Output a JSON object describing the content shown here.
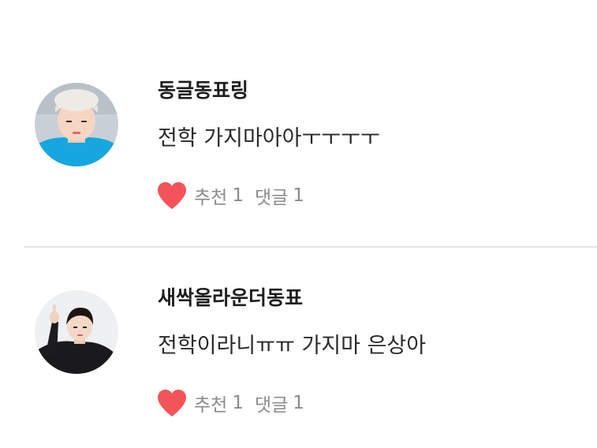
{
  "comments": [
    {
      "username": "동글동표링",
      "text": "전학 가지마아아ㅜㅜㅜㅜ",
      "recommend_label": "추천",
      "recommend_count": "1",
      "reply_label": "댓글",
      "reply_count": "1",
      "avatar_icon": "profile-photo",
      "heart_icon": "heart-icon"
    },
    {
      "username": "새싹올라운더동표",
      "text": "전학이라니ㅠㅠ 가지마 은상아",
      "recommend_label": "추천",
      "recommend_count": "1",
      "reply_label": "댓글",
      "reply_count": "1",
      "avatar_icon": "profile-photo",
      "heart_icon": "heart-icon"
    }
  ],
  "colors": {
    "heart": "#f5535a",
    "meta_text": "#8a8a8a",
    "divider": "#e3e3e3"
  }
}
